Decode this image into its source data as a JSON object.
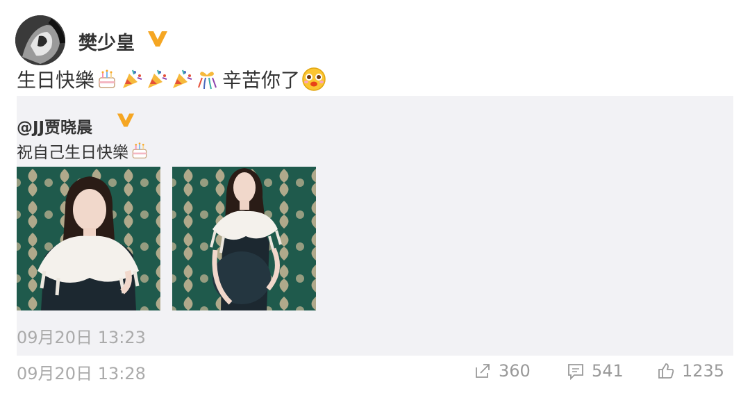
{
  "post": {
    "username": "樊少皇",
    "text_before": "生日快樂",
    "text_after": "辛苦你了",
    "emojis": [
      "cake-emoji",
      "party-popper-emoji",
      "party-popper-emoji",
      "party-popper-emoji",
      "gift-emoji",
      "blush-face-emoji"
    ],
    "time": "09月20日 13:28"
  },
  "repost": {
    "username": "@JJ贾晓晨",
    "text": "祝自己生日快樂",
    "emojis": [
      "cake-emoji"
    ],
    "time": "09月20日 13:23"
  },
  "actions": {
    "share_count": "360",
    "comment_count": "541",
    "like_count": "1235"
  },
  "colors": {
    "verified_badge": "#f5a623",
    "repost_bg": "#f2f2f5",
    "meta_text": "#aaaaaa"
  }
}
